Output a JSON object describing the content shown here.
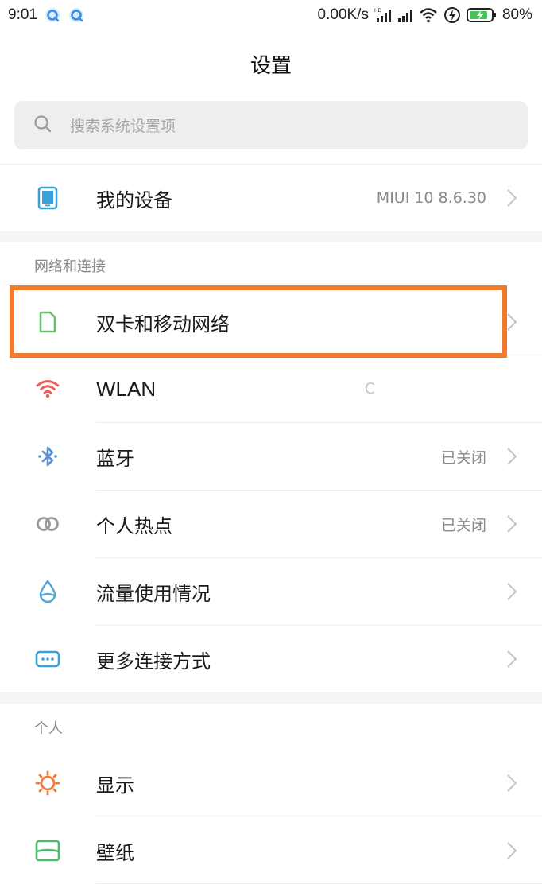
{
  "status_bar": {
    "time": "9:01",
    "speed": "0.00K/s",
    "battery": "80%"
  },
  "header": {
    "title": "设置"
  },
  "search": {
    "placeholder": "搜索系统设置项"
  },
  "device": {
    "label": "我的设备",
    "value": "MIUI 10 8.6.30"
  },
  "network_section": {
    "title": "网络和连接",
    "items": [
      {
        "label": "双卡和移动网络",
        "value": ""
      },
      {
        "label": "WLAN",
        "value": "C"
      },
      {
        "label": "蓝牙",
        "value": "已关闭"
      },
      {
        "label": "个人热点",
        "value": "已关闭"
      },
      {
        "label": "流量使用情况",
        "value": ""
      },
      {
        "label": "更多连接方式",
        "value": ""
      }
    ]
  },
  "personal_section": {
    "title": "个人",
    "items": [
      {
        "label": "显示",
        "value": ""
      },
      {
        "label": "壁纸",
        "value": ""
      }
    ]
  },
  "colors": {
    "sim": "#6abf69",
    "wlan": "#f05a5a",
    "bluetooth": "#5b8fd6",
    "hotspot": "#9a9a9a",
    "data": "#4fa3d8",
    "more": "#3aa0d8",
    "display": "#f07a3a",
    "wallpaper": "#4cbb6c",
    "highlight": "#f27a2d"
  },
  "icons": {
    "device": "tablet-icon",
    "sim": "sim-card-icon",
    "wlan": "wifi-icon",
    "bluetooth": "bluetooth-icon",
    "hotspot": "hotspot-icon",
    "data": "water-drop-icon",
    "more": "more-connections-icon",
    "display": "sun-icon",
    "wallpaper": "wallpaper-icon"
  }
}
